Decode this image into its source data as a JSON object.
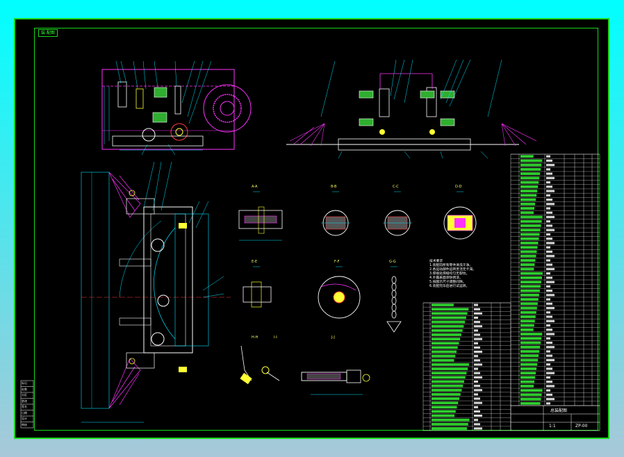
{
  "colors": {
    "background_top": "#00ffff",
    "background_bottom": "#a8c8d8",
    "sheet": "#000000",
    "frame": "#18d818",
    "cyan": "#00e5ff",
    "magenta": "#ff33ff",
    "yellow": "#ffff33",
    "white": "#ffffff",
    "red": "#ff3b3b",
    "green": "#33ff33"
  },
  "sheet": {
    "tag_label": "装 配图",
    "section_labels": [
      "A-A",
      "B-B",
      "C-C",
      "D-D",
      "E-E",
      "F-F",
      "G-G",
      "H-H",
      "I-I",
      "J-J"
    ],
    "scale_label": "1:1"
  },
  "technical_notes": {
    "heading": "技术要求",
    "lines": [
      "1.装配前所有零件清洗干净。",
      "2.各运动部件运转灵活无卡滞。",
      "3.焊接处焊缝均匀无裂纹。",
      "4.外露表面涂防锈漆。",
      "5.按图示尺寸调整间隙。",
      "6.装配完毕后进行试运转。"
    ]
  },
  "title_block": {
    "main_title": "总装配图",
    "drawing_number": "ZP-00",
    "left_column_labels": [
      "标记",
      "处数",
      "分区",
      "更改",
      "签名",
      "日期",
      "设计",
      "审核"
    ]
  },
  "parts_table_right": {
    "rows": 58
  },
  "parts_table_bottom": {
    "rows": 30
  }
}
